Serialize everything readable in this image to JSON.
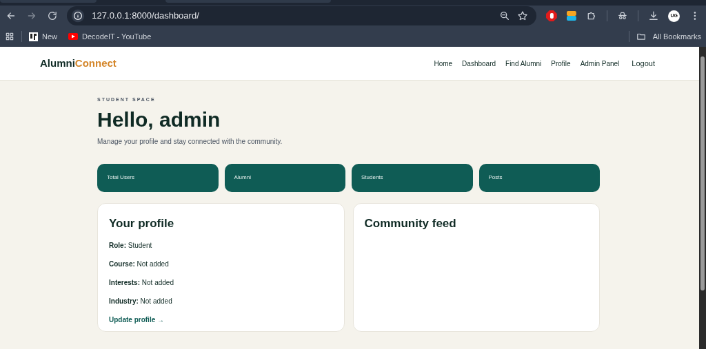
{
  "browser": {
    "url": "127.0.0.1:8000/dashboard/",
    "avatar": "UG",
    "bookmarks": [
      {
        "label": "New",
        "kind": "site"
      },
      {
        "label": "DecodeIT - YouTube",
        "kind": "video"
      }
    ],
    "all_bookmarks": "All Bookmarks"
  },
  "navbar": {
    "brand": [
      "Alumni",
      "Connect"
    ],
    "links": [
      {
        "label": "Home"
      },
      {
        "label": "Dashboard"
      },
      {
        "label": "Find Alumni"
      },
      {
        "label": "Profile"
      },
      {
        "label": "Admin Panel"
      },
      {
        "label": "Logout"
      }
    ]
  },
  "header": {
    "eyebrow": "STUDENT SPACE",
    "title": "Hello, admin",
    "subtitle": "Manage your profile and stay connected with the community."
  },
  "stats": [
    "Total Users",
    "Alumni",
    "Students",
    "Posts"
  ],
  "profile_card": {
    "title": "Your profile",
    "fields": [
      "**Role:** Student",
      "**Course:** Not added",
      "**Interests:** Not added",
      "**Industry:** Not added"
    ],
    "link": "Update profile →"
  },
  "feed_card": {
    "title": "Community feed"
  }
}
